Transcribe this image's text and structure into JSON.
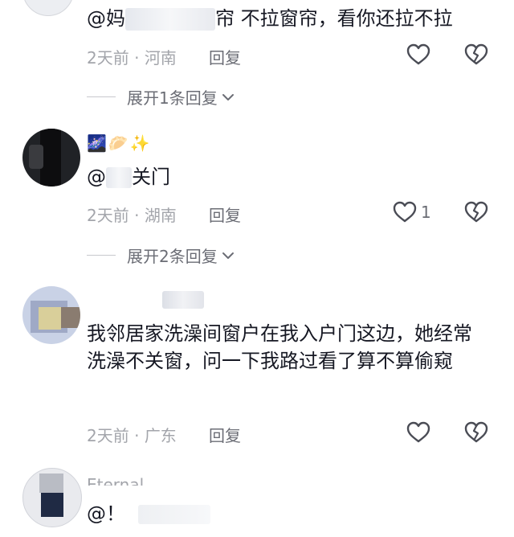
{
  "comments": [
    {
      "text_prefix": "@妈",
      "text_suffix": "帘 不拉窗帘，看你还拉不拉",
      "time": "2天前",
      "location": "河南",
      "reply_label": "回复",
      "like_count": "",
      "expand_label": "展开1条回复"
    },
    {
      "emoji_line": "🌌🥟✨",
      "text_prefix": "@",
      "text_suffix": "关门",
      "time": "2天前",
      "location": "湖南",
      "reply_label": "回复",
      "like_count": "1",
      "expand_label": "展开2条回复"
    },
    {
      "text": "我邻居家洗澡间窗户在我入户门这边，她经常洗澡不关窗，问一下我路过看了算不算偷窥",
      "time": "2天前",
      "location": "广东",
      "reply_label": "回复",
      "like_count": ""
    },
    {
      "username": "Eternal..",
      "text_prefix": "@！"
    }
  ],
  "separator": " · ",
  "colors": {
    "text": "#161823",
    "meta": "#a3a5ab",
    "action": "#6b6d75"
  },
  "icons": [
    "heart-outline-icon",
    "broken-heart-icon",
    "chevron-down-icon"
  ]
}
